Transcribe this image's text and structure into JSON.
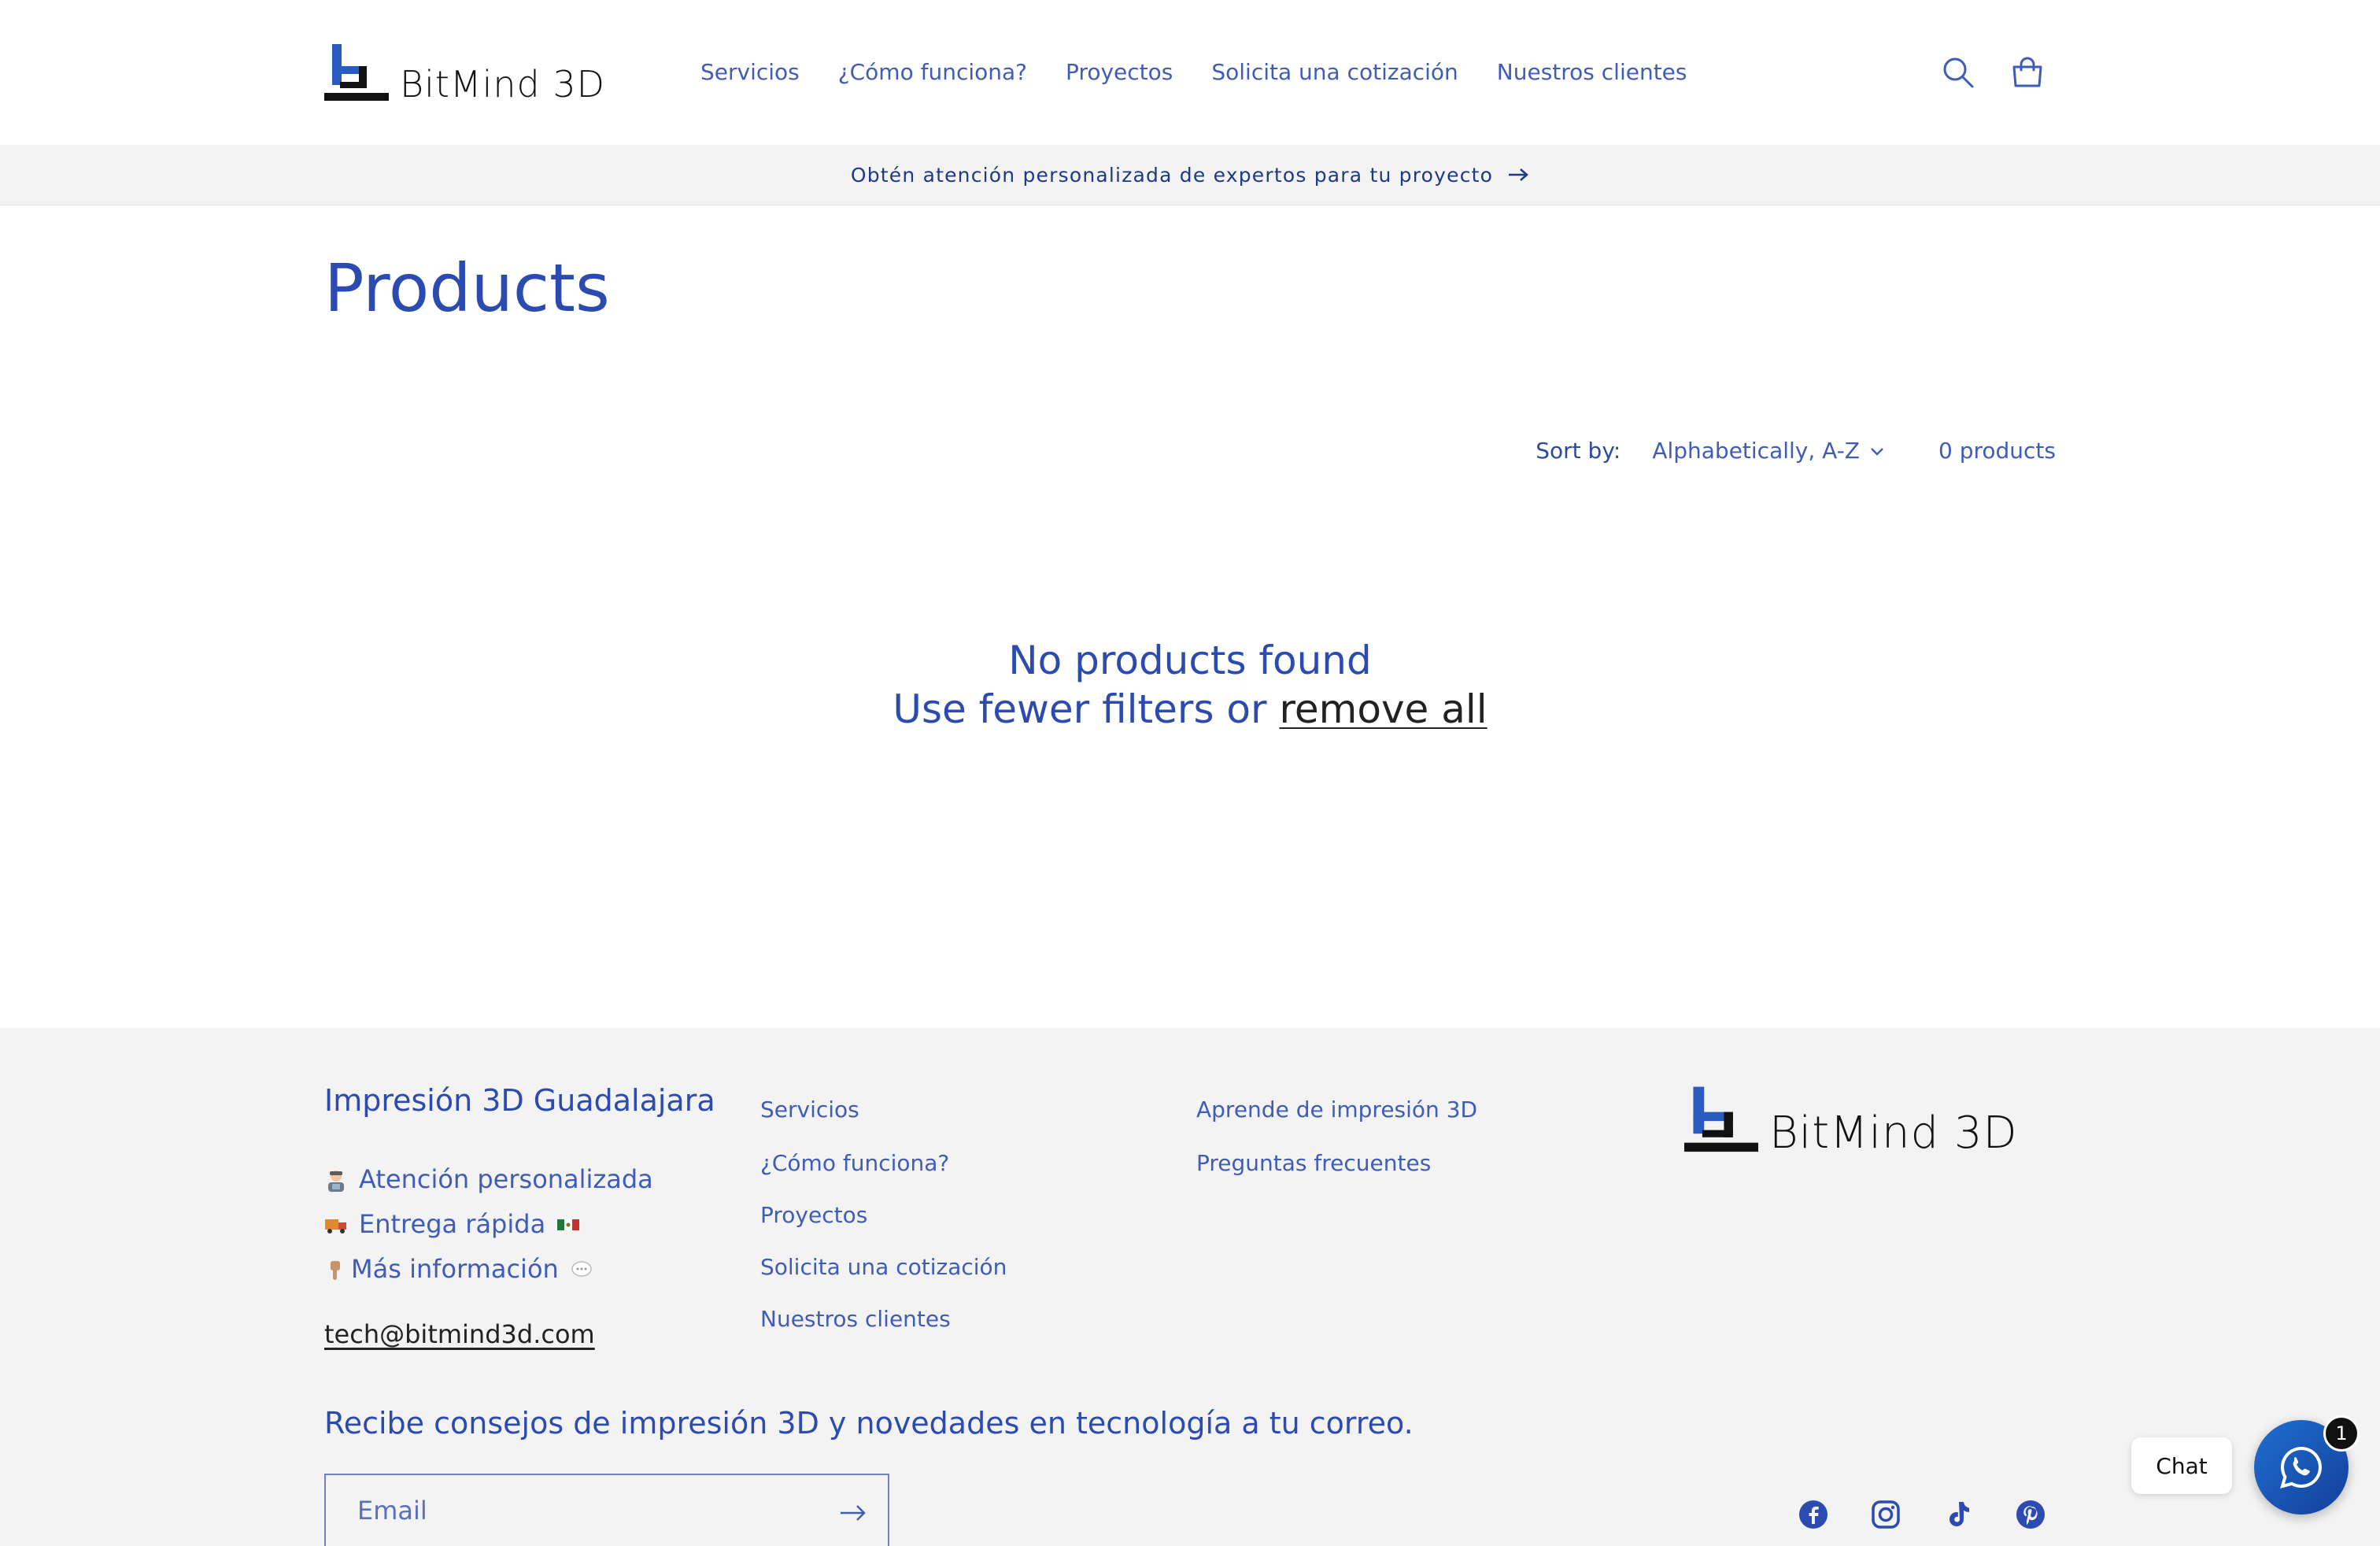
{
  "brand": {
    "name": "BitMind 3D"
  },
  "header": {
    "nav": [
      "Servicios",
      "¿Cómo funciona?",
      "Proyectos",
      "Solicita una cotización",
      "Nuestros clientes"
    ],
    "icons": [
      "search-icon",
      "cart-icon"
    ]
  },
  "announcement": {
    "text": "Obtén atención personalizada de expertos para tu proyecto"
  },
  "main": {
    "title": "Products",
    "sort_label": "Sort by:",
    "sort_value": "Alphabetically, A-Z",
    "product_count": "0 products",
    "empty_title": "No products found",
    "empty_prefix": "Use fewer filters or",
    "empty_link": "remove all"
  },
  "footer": {
    "heading": "Impresión 3D Guadalajara",
    "lines": [
      "Atención personalizada",
      "Entrega rápida",
      "Más información"
    ],
    "email": "tech@bitmind3d.com",
    "col1": [
      "Servicios",
      "¿Cómo funciona?",
      "Proyectos",
      "Solicita una cotización",
      "Nuestros clientes"
    ],
    "col2": [
      "Aprende de impresión 3D",
      "Preguntas frecuentes"
    ],
    "newsletter_heading": "Recibe consejos de impresión 3D y novedades en tecnología a tu correo.",
    "email_placeholder": "Email",
    "socials": [
      "facebook-icon",
      "instagram-icon",
      "tiktok-icon",
      "pinterest-icon"
    ]
  },
  "chat": {
    "label": "Chat",
    "badge": "1"
  },
  "colors": {
    "brand_blue": "#3352b3",
    "footer_bg": "#f3f3f3",
    "chat_blue": "#1f6fd1"
  }
}
